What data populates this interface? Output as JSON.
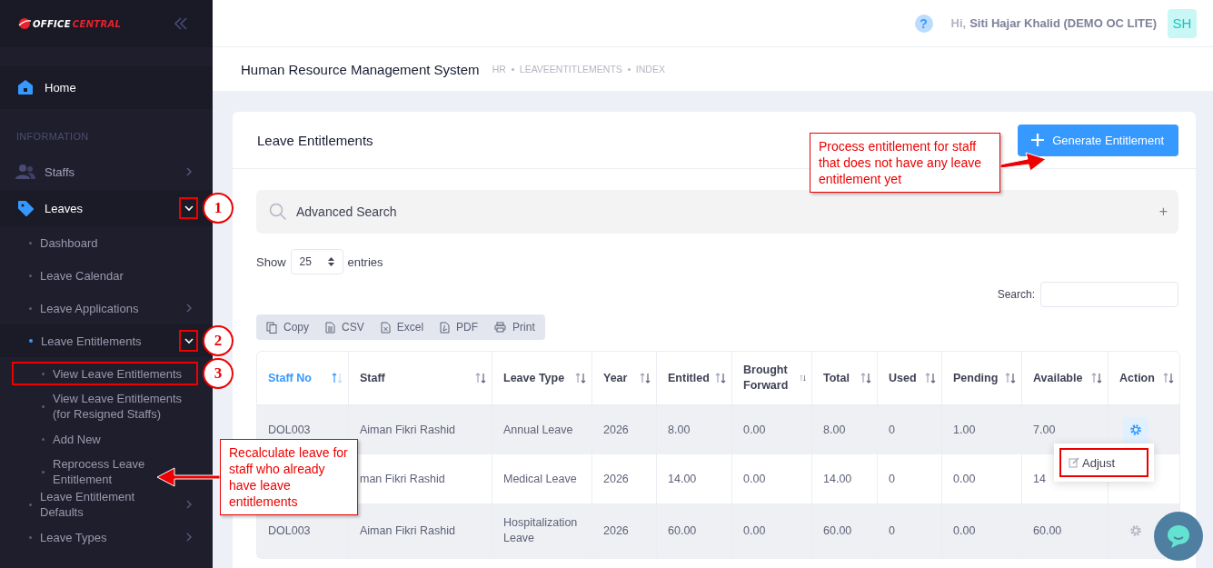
{
  "sidebar": {
    "logo": {
      "part_1": "OFFICE",
      "part_2": "CENTRAL"
    },
    "items": [
      {
        "kind": "link",
        "label": "Home",
        "selected": true
      },
      {
        "kind": "section",
        "label": "INFORMATION"
      },
      {
        "kind": "link",
        "label": "Staffs",
        "selected": false,
        "expanded": false
      },
      {
        "kind": "link",
        "label": "Leaves",
        "selected": true,
        "expanded": true,
        "highlighted": true,
        "marker": "1",
        "children": [
          {
            "label": "Dashboard",
            "selected": false
          },
          {
            "label": "Leave Calendar",
            "selected": false
          },
          {
            "label": "Leave Applications",
            "selected": false,
            "expanded": false
          },
          {
            "label": "Leave Entitlements",
            "selected": true,
            "expanded": true,
            "highlighted": true,
            "marker": "2",
            "children": [
              {
                "label": "View Leave Entitlements",
                "selected": false,
                "highlighted": true,
                "marker": "3"
              },
              {
                "label": "View Leave Entitlements (for Resigned Staffs)",
                "selected": false
              },
              {
                "label": "Add New",
                "selected": false
              },
              {
                "label": "Reprocess Leave Entitlement",
                "selected": false
              }
            ]
          },
          {
            "label": "Leave Entitlement Defaults",
            "selected": false,
            "expanded": false
          },
          {
            "label": "Leave Types",
            "selected": false,
            "expanded": false
          }
        ]
      }
    ]
  },
  "topbar": {
    "help": "?",
    "greeting": "Hi,",
    "user": "Siti Hajar Khalid (DEMO OC LITE)",
    "avatar": "SH"
  },
  "subheader": {
    "title": "Human Resource Management System",
    "breadcrumbs": [
      "HR",
      "LEAVEENTITLEMENTS",
      "INDEX"
    ]
  },
  "card": {
    "title": "Leave Entitlements",
    "primary_button": "Generate Entitlement",
    "advanced_search": {
      "label": "Advanced Search",
      "toggle": "+"
    },
    "length": {
      "before": "Show",
      "value": "25",
      "after": "entries"
    },
    "search": {
      "label": "Search:"
    },
    "export_buttons": [
      {
        "label": "Copy"
      },
      {
        "label": "CSV"
      },
      {
        "label": "Excel"
      },
      {
        "label": "PDF"
      },
      {
        "label": "Print"
      }
    ],
    "table": {
      "columns": [
        {
          "label": "Staff No",
          "sorted": true
        },
        {
          "label": "Staff",
          "sorted": false
        },
        {
          "label": "Leave Type",
          "sorted": false
        },
        {
          "label": "Year",
          "sorted": false
        },
        {
          "label": "Entitled",
          "sorted": false
        },
        {
          "label": "Brought Forward",
          "sorted": false
        },
        {
          "label": "Total",
          "sorted": false
        },
        {
          "label": "Used",
          "sorted": false
        },
        {
          "label": "Pending",
          "sorted": false
        },
        {
          "label": "Available",
          "sorted": false
        },
        {
          "label": "Action",
          "sorted": false
        }
      ],
      "rows": [
        {
          "staff_no": "DOL003",
          "staff": "Aiman Fikri Rashid",
          "leave_type": "Annual Leave",
          "year": "2026",
          "entitled": "8.00",
          "brought_forward": "0.00",
          "total": "8.00",
          "used": "0",
          "pending": "1.00",
          "available": "7.00",
          "menu_open": true,
          "menu": [
            {
              "label": "Adjust",
              "highlighted": true
            }
          ]
        },
        {
          "staff": "man Fikri Rashid",
          "leave_type": "Medical Leave",
          "year": "2026",
          "entitled": "14.00",
          "brought_forward": "0.00",
          "total": "14.00",
          "used": "0",
          "pending": "0.00",
          "available": "14"
        },
        {
          "staff_no": "DOL003",
          "staff": "Aiman Fikri Rashid",
          "leave_type": "Hospitalization Leave",
          "year": "2026",
          "entitled": "60.00",
          "brought_forward": "0.00",
          "total": "60.00",
          "used": "0",
          "pending": "0.00",
          "available": "60.00",
          "menu_open": false
        }
      ]
    }
  },
  "callouts": [
    {
      "text": "Process entitlement for staff that does not have any leave entitlement yet"
    },
    {
      "text": "Recalculate leave for staff who already have leave entitlements"
    }
  ]
}
